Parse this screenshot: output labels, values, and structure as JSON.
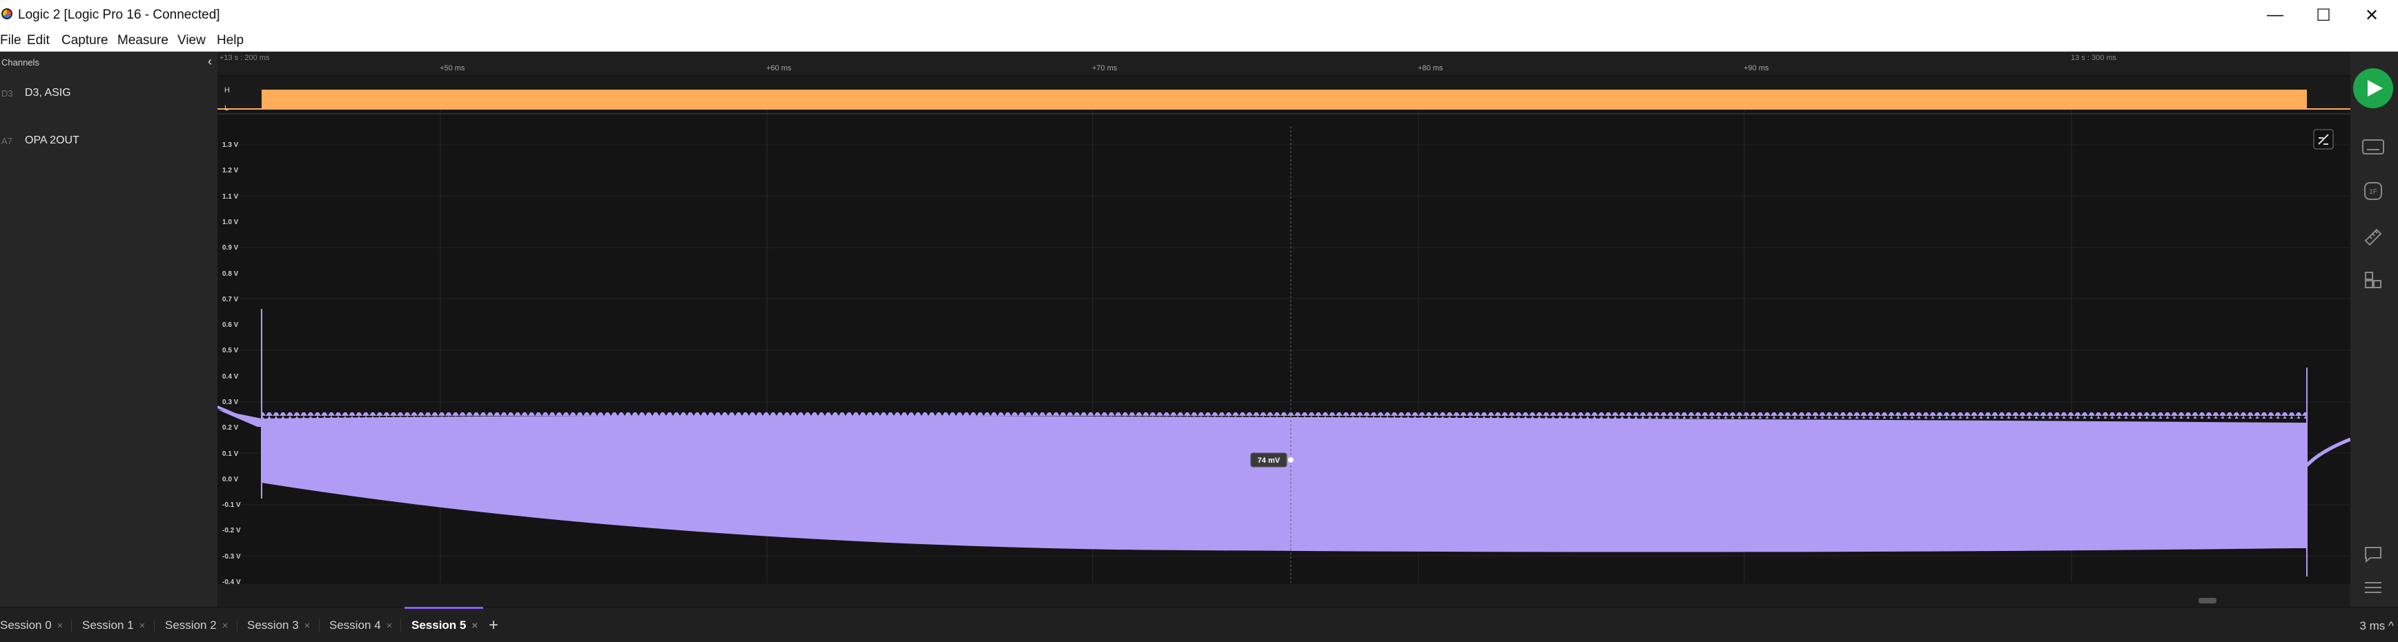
{
  "window": {
    "title": "Logic 2 [Logic Pro 16 - Connected]",
    "minimize_glyph": "—",
    "maximize_glyph": "☐",
    "close_glyph": "✕"
  },
  "menu": [
    "File",
    "Edit",
    "Capture",
    "Measure",
    "View",
    "Help"
  ],
  "sidebar": {
    "header": "Channels",
    "collapse_glyph": "‹",
    "channels": [
      {
        "index": "D3",
        "name": "D3, ASIG"
      },
      {
        "index": "A7",
        "name": "OPA 2OUT"
      }
    ]
  },
  "timeline": {
    "start_label": "+13 s : 200 ms",
    "end_label": "13 s : 300 ms",
    "tick_labels": [
      "+50 ms",
      "+60 ms",
      "+70 ms",
      "+80 ms",
      "+90 ms"
    ]
  },
  "digital_channel": {
    "high_label": "H",
    "low_label": "L",
    "fill_color": "#ffad5a"
  },
  "analog_channel": {
    "y_labels": [
      "1.3 V",
      "1.2 V",
      "1.1 V",
      "1.0 V",
      "0.9 V",
      "0.8 V",
      "0.7 V",
      "0.6 V",
      "0.5 V",
      "0.4 V",
      "0.3 V",
      "0.2 V",
      "0.1 V",
      "0.0 V",
      "-0.1 V",
      "-0.2 V",
      "-0.3 V",
      "-0.4 V"
    ],
    "waveform_color": "#b19cf5",
    "cursor_value": "74 mV"
  },
  "tabs": [
    {
      "label": "Session 0",
      "active": false
    },
    {
      "label": "Session 1",
      "active": false
    },
    {
      "label": "Session 2",
      "active": false
    },
    {
      "label": "Session 3",
      "active": false
    },
    {
      "label": "Session 4",
      "active": false
    },
    {
      "label": "Session 5",
      "active": true
    }
  ],
  "tab_close_glyph": "×",
  "add_tab_glyph": "+",
  "zoom_label": "3 ms ^",
  "icons": {
    "play": "play-icon",
    "keyboard": "keyboard-icon",
    "analyzer": "analyzer-icon",
    "measure": "ruler-icon",
    "extensions": "extensions-icon",
    "annotations": "comment-icon",
    "menu": "hamburger-icon"
  }
}
